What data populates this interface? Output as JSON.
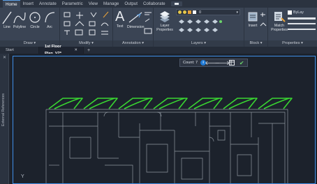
{
  "menu": {
    "tabs": [
      "Home",
      "Insert",
      "Annotate",
      "Parametric",
      "View",
      "Manage",
      "Output",
      "Collaborate"
    ],
    "active_tab": "Home"
  },
  "ribbon": {
    "draw": {
      "title": "Draw",
      "tools": [
        "Line",
        "Polyline",
        "Circle",
        "Arc"
      ]
    },
    "modify": {
      "title": "Modify"
    },
    "annotation": {
      "title": "Annotation",
      "text_label": "Text",
      "dimension_label": "Dimension"
    },
    "layers": {
      "title": "Layers",
      "layer_properties_label": "Layer Properties",
      "current_layer": "0"
    },
    "block": {
      "title": "Block",
      "insert_label": "Insert"
    },
    "properties": {
      "title": "Properties",
      "match_label": "Match Properties",
      "bylayer": "ByLay"
    }
  },
  "doc_tabs": {
    "start": "Start",
    "active": "1st Floor Plan_V2*",
    "close_glyph": "✕",
    "plus_glyph": "+"
  },
  "side_palette": {
    "label": "External References",
    "close_glyph": "✕"
  },
  "count_bar": {
    "label": "Count:",
    "value": "7",
    "badge": "i"
  },
  "ucs_label": "Y",
  "colors": {
    "accent": "#3f8fe8",
    "highlight": "#39d631",
    "background": "#1c222c"
  }
}
